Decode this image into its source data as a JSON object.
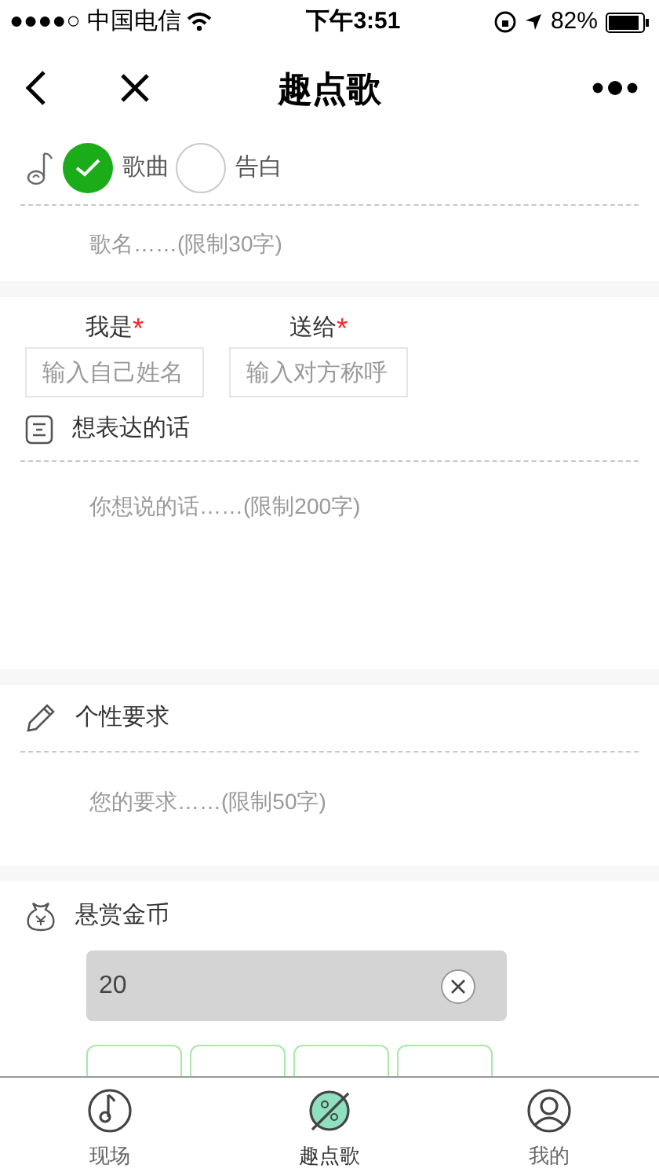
{
  "status_bar": {
    "carrier": "●●●●○ 中国电信",
    "time": "下午3:51",
    "battery": "82%"
  },
  "nav": {
    "title": "趣点歌"
  },
  "type_options": [
    {
      "label": "歌曲",
      "selected": true
    },
    {
      "label": "告白",
      "selected": false
    }
  ],
  "song_field": {
    "placeholder": "歌名……(限制30字)"
  },
  "people": [
    {
      "label": "我是",
      "required_mark": "*",
      "placeholder": "输入自己姓名"
    },
    {
      "label": "送给",
      "required_mark": "*",
      "placeholder": "输入对方称呼"
    }
  ],
  "message": {
    "heading": "想表达的话",
    "placeholder": "你想说的话……(限制200字)"
  },
  "request": {
    "heading": "个性要求",
    "placeholder": "您的要求……(限制50字)"
  },
  "reward": {
    "heading": "悬赏金币",
    "value": "20"
  },
  "tabs": [
    {
      "label": "现场",
      "selected": false
    },
    {
      "label": "趣点歌",
      "selected": true
    },
    {
      "label": "我的",
      "selected": false
    }
  ]
}
